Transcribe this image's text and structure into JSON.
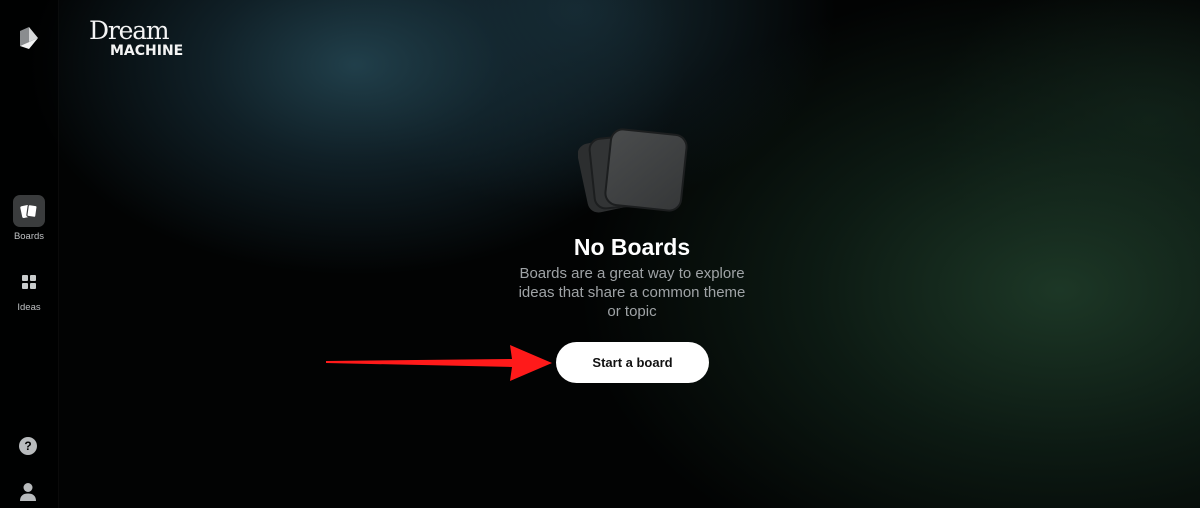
{
  "brand": {
    "line1": "Dream",
    "line2": "MACHINE"
  },
  "sidebar": {
    "logo_icon": "luma-logo-icon",
    "items": [
      {
        "label": "Boards",
        "icon": "boards-icon",
        "active": true
      },
      {
        "label": "Ideas",
        "icon": "grid-icon",
        "active": false
      }
    ],
    "help": {
      "glyph": "?",
      "icon": "help-icon"
    },
    "profile": {
      "icon": "user-icon"
    }
  },
  "empty_state": {
    "icon": "stacked-cards-icon",
    "title": "No Boards",
    "description": "Boards are a great way to explore ideas that share a common theme or topic",
    "button_label": "Start a board"
  },
  "annotation": {
    "icon": "red-arrow-icon",
    "color": "#ff1a1a"
  },
  "colors": {
    "background": "#020303",
    "button_bg": "#ffffff",
    "active_nav_bg": "#3a3c3d",
    "muted_text": "#9fa3a6"
  }
}
